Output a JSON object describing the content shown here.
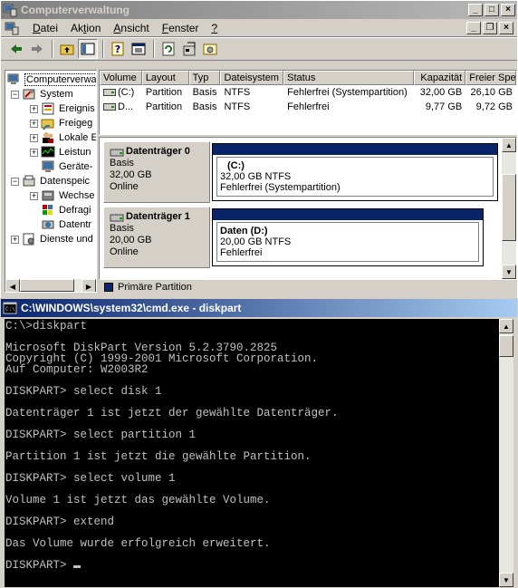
{
  "cm_window": {
    "title": "Computerverwaltung",
    "menu": [
      {
        "pre": "",
        "u": "D",
        "post": "atei"
      },
      {
        "pre": "Ak",
        "u": "t",
        "post": "ion"
      },
      {
        "pre": "",
        "u": "A",
        "post": "nsicht"
      },
      {
        "pre": "",
        "u": "F",
        "post": "enster"
      },
      {
        "pre": "",
        "u": "?",
        "post": ""
      }
    ],
    "toolbar": [
      "back-icon",
      "forward-icon",
      "up-folder-icon",
      "show-tree-icon",
      "help-icon",
      "properties-icon",
      "refresh-icon",
      "export-icon",
      "settings-icon"
    ],
    "tree": [
      {
        "label": "Computerverwa",
        "icon": "computer-icon",
        "level": 0,
        "expander": ""
      },
      {
        "label": "System",
        "icon": "system-tools-icon",
        "level": 1,
        "expander": "−"
      },
      {
        "label": "Ereignis",
        "icon": "event-viewer-icon",
        "level": 2,
        "expander": "+"
      },
      {
        "label": "Freigeg",
        "icon": "shared-folder-icon",
        "level": 2,
        "expander": "+"
      },
      {
        "label": "Lokale E",
        "icon": "users-icon",
        "level": 2,
        "expander": "+"
      },
      {
        "label": "Leistun",
        "icon": "performance-icon",
        "level": 2,
        "expander": "+"
      },
      {
        "label": "Geräte-",
        "icon": "device-manager-icon",
        "level": 2,
        "expander": ""
      },
      {
        "label": "Datenspeic",
        "icon": "storage-icon",
        "level": 1,
        "expander": "−"
      },
      {
        "label": "Wechse",
        "icon": "removable-storage-icon",
        "level": 2,
        "expander": "+"
      },
      {
        "label": "Defragi",
        "icon": "defrag-icon",
        "level": 2,
        "expander": ""
      },
      {
        "label": "Datentr",
        "icon": "disk-management-icon",
        "level": 2,
        "expander": ""
      },
      {
        "label": "Dienste und",
        "icon": "services-icon",
        "level": 1,
        "expander": "+"
      }
    ],
    "volumes": {
      "headers": [
        "Volume",
        "Layout",
        "Typ",
        "Dateisystem",
        "Status",
        "Kapazität",
        "Freier Spe"
      ],
      "rows": [
        [
          "(C:)",
          "Partition",
          "Basis",
          "NTFS",
          "Fehlerfrei (Systempartition)",
          "32,00 GB",
          "26,10 GB"
        ],
        [
          "D...",
          "Partition",
          "Basis",
          "NTFS",
          "Fehlerfrei",
          "9,77 GB",
          "9,72 GB"
        ]
      ]
    },
    "disks": [
      {
        "name": "Datenträger 0",
        "type": "Basis",
        "size": "32,00 GB",
        "state": "Online",
        "partition": {
          "name": "(C:)",
          "size": "32,00 GB NTFS",
          "status": "Fehlerfrei (Systempartition)"
        }
      },
      {
        "name": "Datenträger 1",
        "type": "Basis",
        "size": "20,00 GB",
        "state": "Online",
        "partition": {
          "name": "Daten  (D:)",
          "size": "20,00 GB NTFS",
          "status": "Fehlerfrei"
        }
      }
    ],
    "legend": "Primäre Partition",
    "legend_color": "#0a246a"
  },
  "cmd_window": {
    "title": "C:\\WINDOWS\\system32\\cmd.exe - diskpart",
    "lines": [
      "C:\\>diskpart",
      "",
      "Microsoft DiskPart Version 5.2.3790.2825",
      "Copyright (C) 1999-2001 Microsoft Corporation.",
      "Auf Computer: W2003R2",
      "",
      "DISKPART> select disk 1",
      "",
      "Datenträger 1 ist jetzt der gewählte Datenträger.",
      "",
      "DISKPART> select partition 1",
      "",
      "Partition 1 ist jetzt die gewählte Partition.",
      "",
      "DISKPART> select volume 1",
      "",
      "Volume 1 ist jetzt das gewählte Volume.",
      "",
      "DISKPART> extend",
      "",
      "Das Volume wurde erfolgreich erweitert.",
      "",
      "DISKPART> "
    ]
  }
}
